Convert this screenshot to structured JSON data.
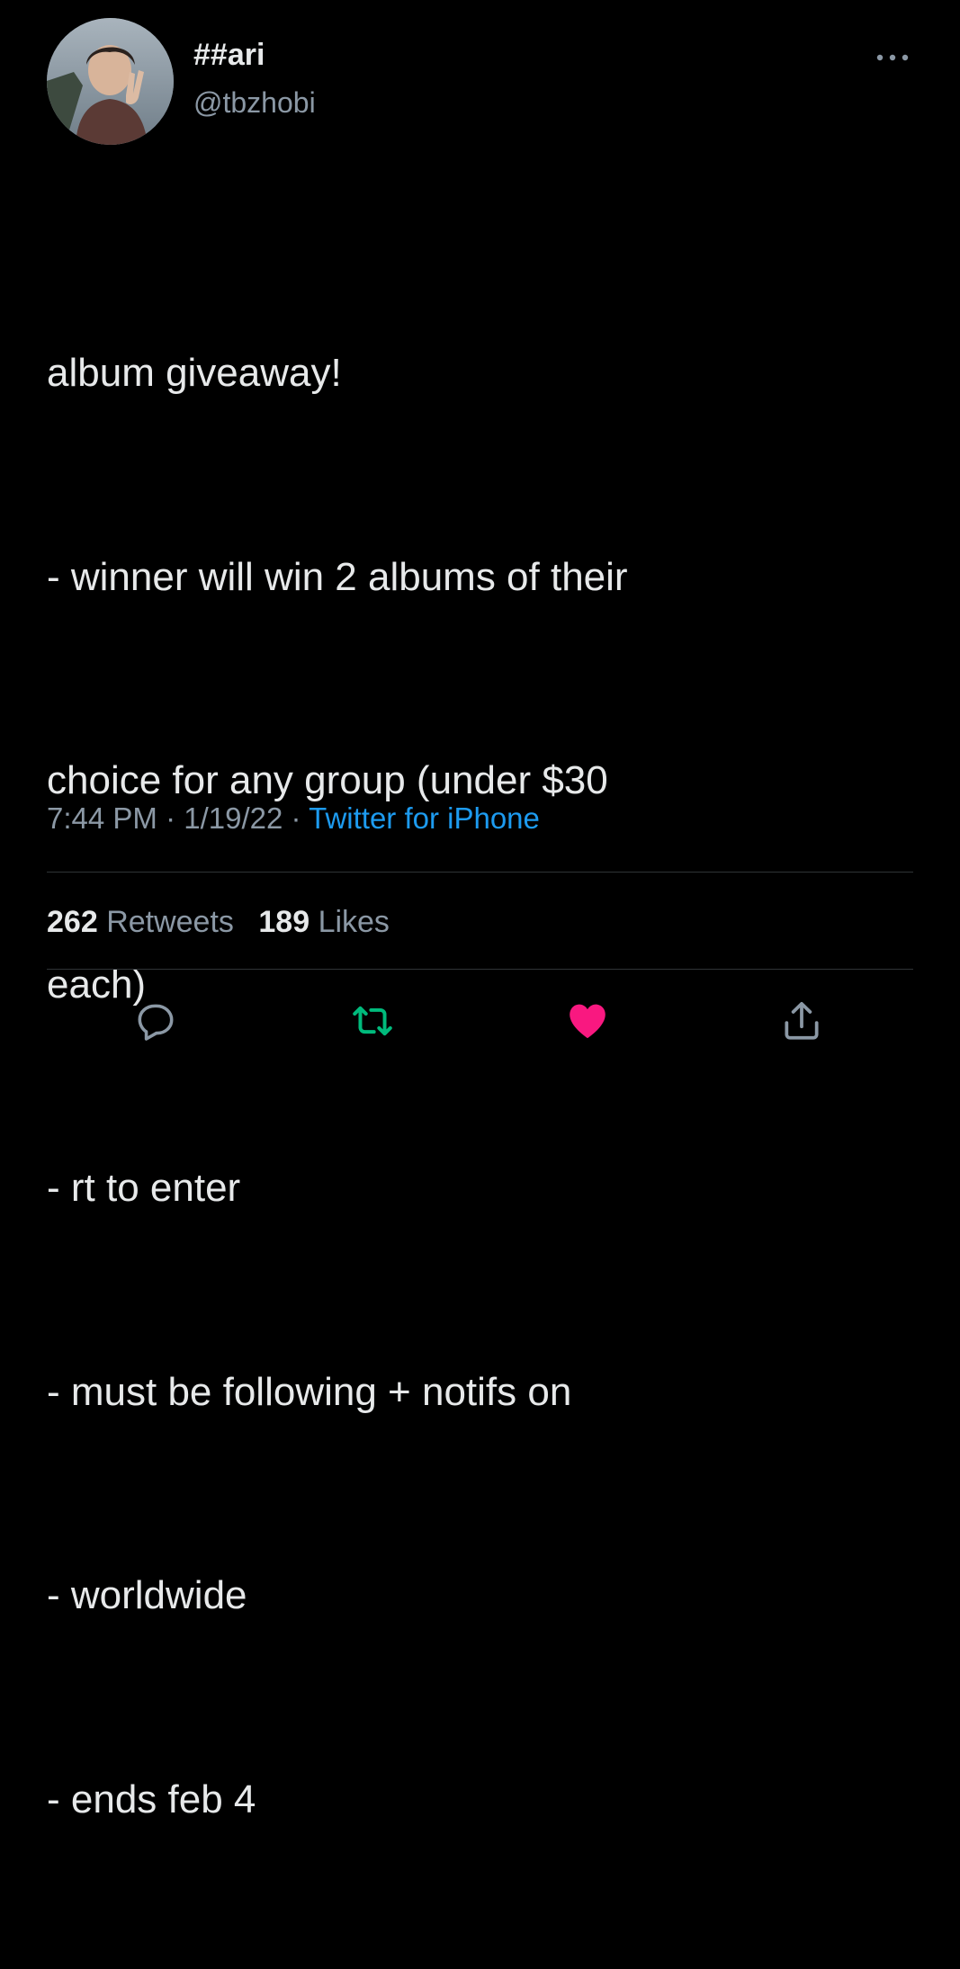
{
  "author": {
    "display_name": "##ari",
    "handle": "@tbzhobi"
  },
  "tweet": {
    "lines": [
      "album giveaway!",
      "- winner will win 2 albums of their",
      "choice for any group (under $30",
      "each)",
      "- rt to enter",
      "- must be following + notifs on",
      "- worldwide",
      "- ends feb 4"
    ],
    "time": "7:44 PM",
    "separator": "·",
    "date": "1/19/22",
    "source": "Twitter for iPhone"
  },
  "stats": {
    "retweets_count": "262",
    "retweets_label": "Retweets",
    "likes_count": "189",
    "likes_label": "Likes"
  },
  "actions": {
    "reply_icon": "reply-icon",
    "retweet_icon": "retweet-icon",
    "like_icon": "heart-icon",
    "share_icon": "share-icon",
    "more_icon": "more-icon"
  },
  "colors": {
    "background": "#000000",
    "text_primary": "#e7e9ea",
    "text_secondary": "#8b98a5",
    "link": "#1d9bf0",
    "retweet_active": "#00ba7c",
    "like_active": "#f91880",
    "divider": "#2f3336"
  }
}
